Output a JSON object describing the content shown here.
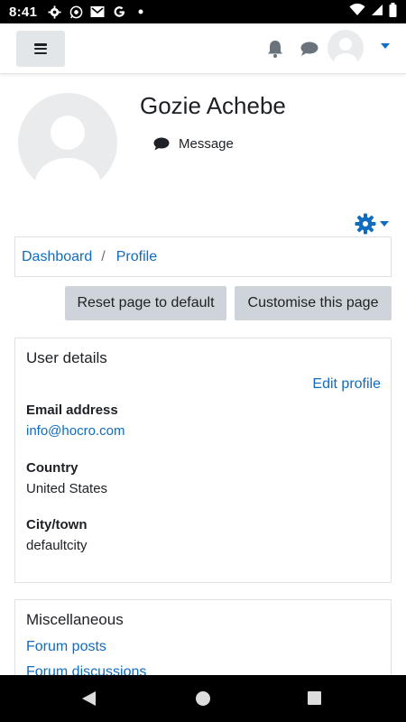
{
  "status_bar": {
    "time": "8:41",
    "icons": [
      "settings-icon",
      "whatsapp-icon",
      "mail-icon",
      "google-icon",
      "dot-icon"
    ],
    "right_icons": [
      "wifi-icon",
      "signal-icon",
      "battery-icon"
    ]
  },
  "header": {
    "menu_icon": "hamburger-icon",
    "notification_icon": "bell-icon",
    "messages_icon": "chat-icon",
    "user_menu_icon": "chevron-down-icon"
  },
  "profile": {
    "name": "Gozie Achebe",
    "message_label": "Message"
  },
  "breadcrumb": {
    "items": [
      "Dashboard",
      "Profile"
    ],
    "separator": "/"
  },
  "actions": {
    "reset_label": "Reset page to default",
    "customise_label": "Customise this page"
  },
  "user_details": {
    "title": "User details",
    "edit_label": "Edit profile",
    "fields": [
      {
        "label": "Email address",
        "value": "info@hocro.com"
      },
      {
        "label": "Country",
        "value": "United States"
      },
      {
        "label": "City/town",
        "value": "defaultcity"
      }
    ]
  },
  "miscellaneous": {
    "title": "Miscellaneous",
    "links": [
      "Forum posts",
      "Forum discussions"
    ]
  },
  "colors": {
    "link": "#0f6cbf",
    "button_bg": "#ced4da",
    "menu_button_bg": "#e3e6e8",
    "avatar_bg": "#e9ebec"
  }
}
